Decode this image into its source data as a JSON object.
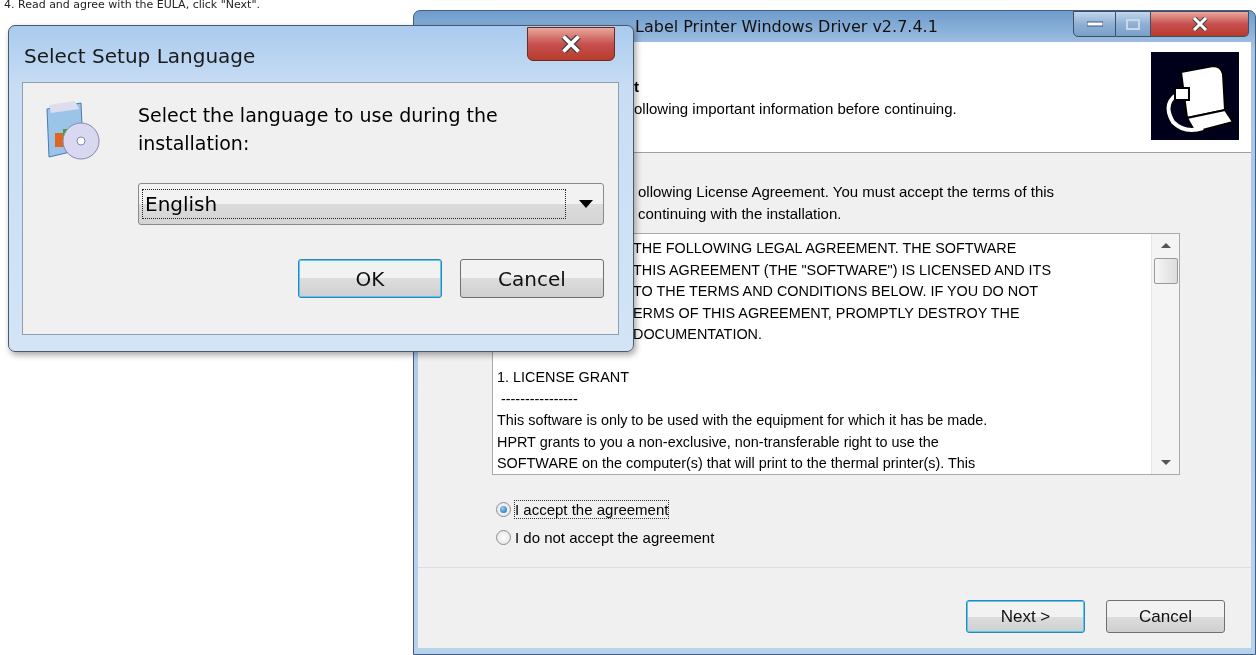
{
  "caption": "4. Read and agree with the EULA, click \"Next\".",
  "setup_window": {
    "title": "Label Printer Windows Driver v2.7.4.1",
    "heading": "t",
    "subheading": "ollowing important information before continuing.",
    "instructions": [
      "ollowing License Agreement. You must accept the terms of this",
      "continuing with the installation."
    ],
    "license_text": {
      "partial_lines": [
        "THE FOLLOWING LEGAL AGREEMENT. THE SOFTWARE",
        "THIS AGREEMENT (THE \"SOFTWARE\") IS LICENSED AND ITS",
        "TO THE TERMS AND CONDITIONS BELOW. IF YOU DO NOT",
        "ERMS OF THIS AGREEMENT, PROMPTLY DESTROY THE",
        "DOCUMENTATION."
      ],
      "lines": [
        "1. LICENSE GRANT",
        " ----------------",
        "This software is only to be used with the equipment for which it has be made.",
        "HPRT grants to you a non-exclusive, non-transferable right to use the",
        "SOFTWARE on the computer(s) that will print to the thermal printer(s). This"
      ]
    },
    "options": [
      {
        "label": "I accept the agreement",
        "selected": true
      },
      {
        "label": "I do not accept the agreement",
        "selected": false
      }
    ],
    "buttons": [
      {
        "label": "Next >",
        "default": true
      },
      {
        "label": "Cancel",
        "default": false
      }
    ]
  },
  "language_dialog": {
    "title": "Select Setup Language",
    "prompt": "Select the language to use during the installation:",
    "language": "English",
    "buttons": [
      {
        "label": "OK",
        "default": true
      },
      {
        "label": "Cancel",
        "default": false
      }
    ]
  }
}
